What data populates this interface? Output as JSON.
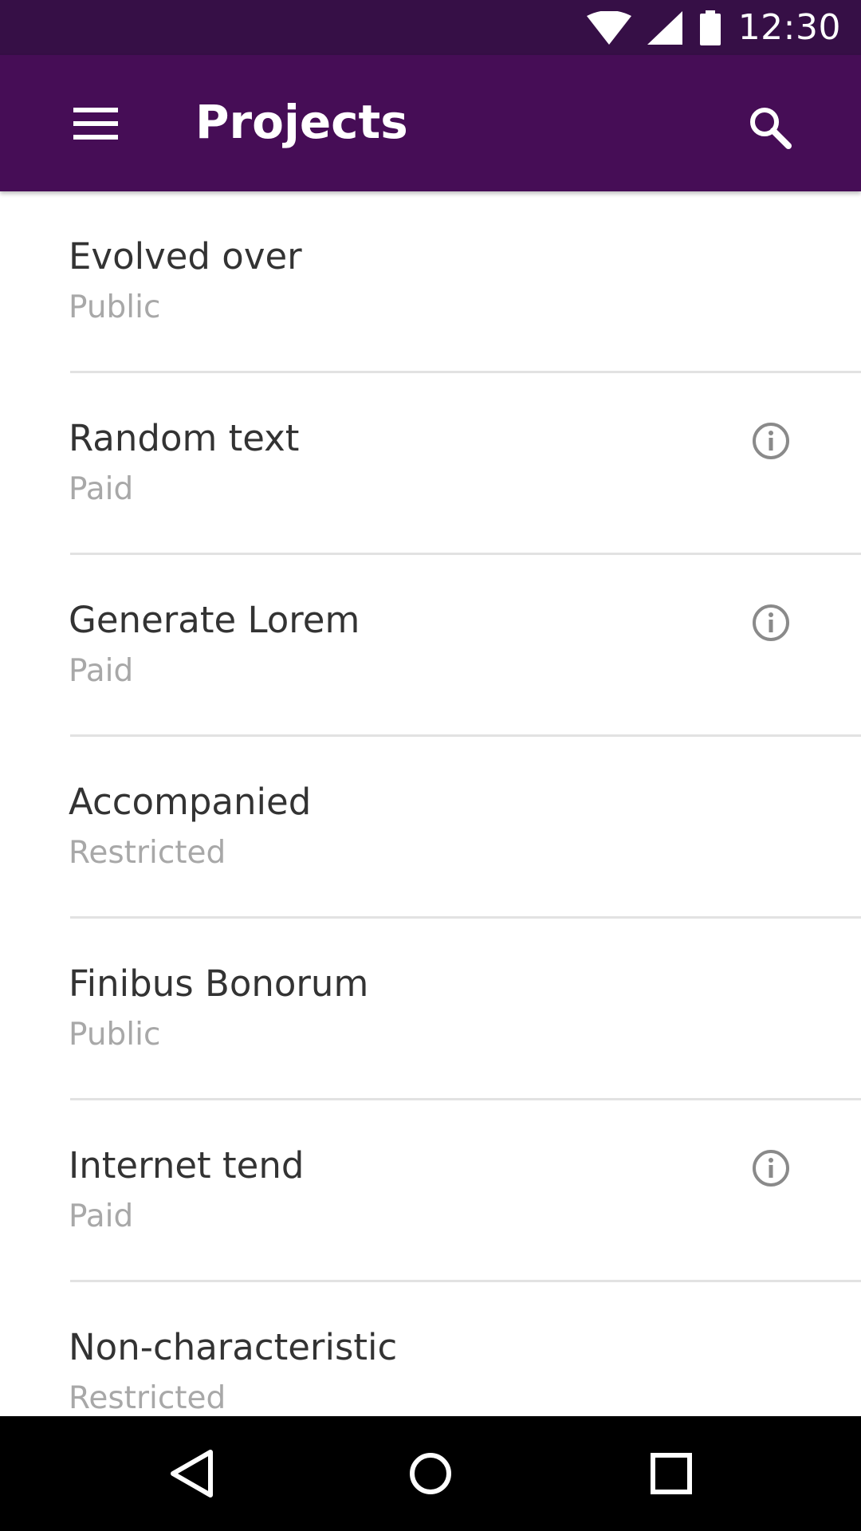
{
  "status_bar": {
    "time": "12:30",
    "icons": [
      "wifi-icon",
      "cell-signal-icon",
      "battery-icon"
    ]
  },
  "app_bar": {
    "title": "Projects",
    "menu_icon": "hamburger-menu-icon",
    "search_icon": "search-icon",
    "background_color": "#460d56",
    "status_color": "#360f46"
  },
  "projects": [
    {
      "name": "Evolved over",
      "access": "Public",
      "info": false
    },
    {
      "name": "Random text",
      "access": "Paid",
      "info": true
    },
    {
      "name": "Generate Lorem",
      "access": "Paid",
      "info": true
    },
    {
      "name": "Accompanied",
      "access": "Restricted",
      "info": false
    },
    {
      "name": "Finibus Bonorum",
      "access": "Public",
      "info": false
    },
    {
      "name": "Internet tend",
      "access": "Paid",
      "info": true
    },
    {
      "name": "Non-characteristic",
      "access": "Restricted",
      "info": false
    }
  ],
  "nav_bar": {
    "icons": [
      "back-icon",
      "home-icon",
      "recents-icon"
    ]
  }
}
